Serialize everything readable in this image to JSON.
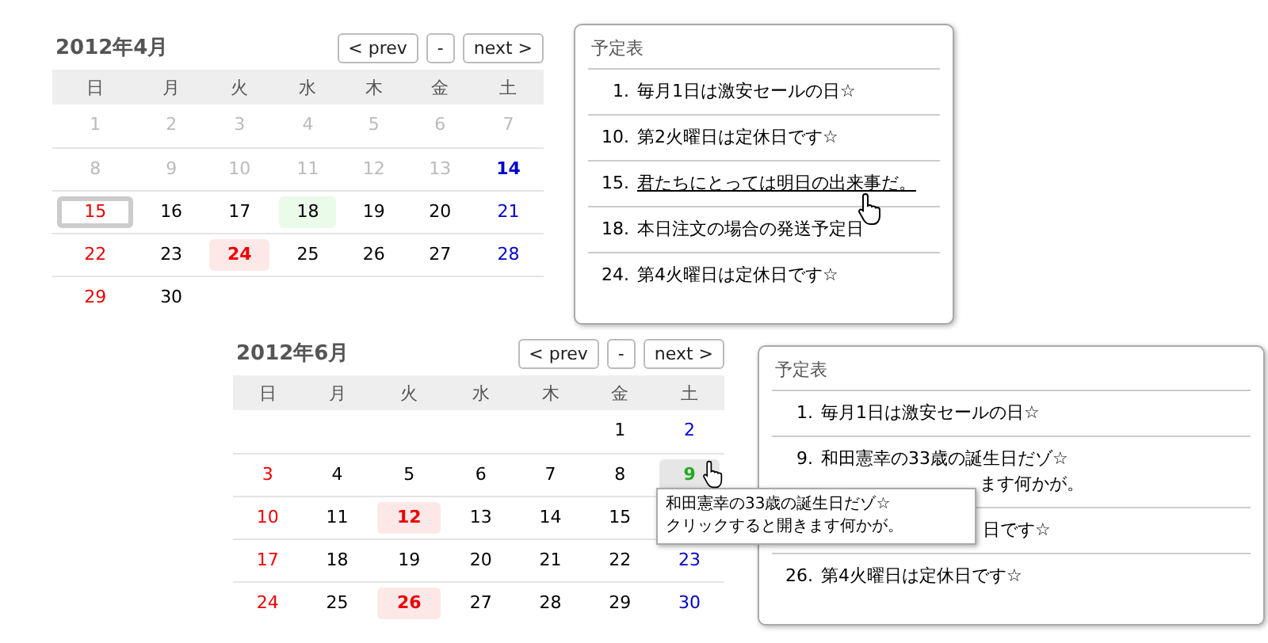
{
  "calendars": [
    {
      "title": "2012年4月",
      "buttons": [
        "< prev",
        "-",
        "next >"
      ],
      "weekdays": [
        "日",
        "月",
        "火",
        "水",
        "木",
        "金",
        "土"
      ],
      "weeks": [
        [
          {
            "day": "1",
            "kind": "past",
            "selected": false
          },
          {
            "day": "2",
            "kind": "past",
            "selected": false
          },
          {
            "day": "3",
            "kind": "past",
            "selected": false
          },
          {
            "day": "4",
            "kind": "past",
            "selected": false
          },
          {
            "day": "5",
            "kind": "past",
            "selected": false
          },
          {
            "day": "6",
            "kind": "past",
            "selected": false
          },
          {
            "day": "7",
            "kind": "past",
            "selected": false
          }
        ],
        [
          {
            "day": "8",
            "kind": "past",
            "selected": false
          },
          {
            "day": "9",
            "kind": "past",
            "selected": false
          },
          {
            "day": "10",
            "kind": "past",
            "selected": false
          },
          {
            "day": "11",
            "kind": "past",
            "selected": false
          },
          {
            "day": "12",
            "kind": "past",
            "selected": false
          },
          {
            "day": "13",
            "kind": "past",
            "selected": false
          },
          {
            "day": "14",
            "kind": "saturday",
            "bold": true,
            "selected": false
          }
        ],
        [
          {
            "day": "15",
            "kind": "sunday",
            "selected": true
          },
          {
            "day": "16",
            "kind": "weekday",
            "selected": false
          },
          {
            "day": "17",
            "kind": "weekday",
            "selected": false
          },
          {
            "day": "18",
            "kind": "weekday",
            "event": true,
            "selected": false
          },
          {
            "day": "19",
            "kind": "weekday",
            "selected": false
          },
          {
            "day": "20",
            "kind": "weekday",
            "selected": false
          },
          {
            "day": "21",
            "kind": "saturday",
            "selected": false
          }
        ],
        [
          {
            "day": "22",
            "kind": "sunday",
            "selected": false
          },
          {
            "day": "23",
            "kind": "weekday",
            "selected": false
          },
          {
            "day": "24",
            "kind": "weekday",
            "closed": true,
            "selected": false
          },
          {
            "day": "25",
            "kind": "weekday",
            "selected": false
          },
          {
            "day": "26",
            "kind": "weekday",
            "selected": false
          },
          {
            "day": "27",
            "kind": "weekday",
            "selected": false
          },
          {
            "day": "28",
            "kind": "saturday",
            "selected": false
          }
        ],
        [
          {
            "day": "29",
            "kind": "sunday",
            "selected": false
          },
          {
            "day": "30",
            "kind": "weekday",
            "selected": false
          },
          {
            "kind": "blank"
          },
          {
            "kind": "blank"
          },
          {
            "kind": "blank"
          },
          {
            "kind": "blank"
          },
          {
            "kind": "blank"
          }
        ]
      ]
    },
    {
      "title": "2012年6月",
      "buttons": [
        "< prev",
        "-",
        "next >"
      ],
      "weekdays": [
        "日",
        "月",
        "火",
        "水",
        "木",
        "金",
        "土"
      ],
      "weeks": [
        [
          {
            "kind": "blank"
          },
          {
            "kind": "blank"
          },
          {
            "kind": "blank"
          },
          {
            "kind": "blank"
          },
          {
            "kind": "blank"
          },
          {
            "day": "1",
            "kind": "weekday"
          },
          {
            "day": "2",
            "kind": "saturday"
          }
        ],
        [
          {
            "day": "3",
            "kind": "sunday"
          },
          {
            "day": "4",
            "kind": "weekday"
          },
          {
            "day": "5",
            "kind": "weekday"
          },
          {
            "day": "6",
            "kind": "weekday"
          },
          {
            "day": "7",
            "kind": "weekday"
          },
          {
            "day": "8",
            "kind": "weekday"
          },
          {
            "day": "9",
            "kind": "saturday",
            "hover": true
          }
        ],
        [
          {
            "day": "10",
            "kind": "sunday"
          },
          {
            "day": "11",
            "kind": "weekday"
          },
          {
            "day": "12",
            "kind": "weekday",
            "closed": true
          },
          {
            "day": "13",
            "kind": "weekday"
          },
          {
            "day": "14",
            "kind": "weekday"
          },
          {
            "day": "15",
            "kind": "weekday"
          },
          {
            "kind": "blank"
          }
        ],
        [
          {
            "day": "17",
            "kind": "sunday"
          },
          {
            "day": "18",
            "kind": "weekday"
          },
          {
            "day": "19",
            "kind": "weekday"
          },
          {
            "day": "20",
            "kind": "weekday"
          },
          {
            "day": "21",
            "kind": "weekday"
          },
          {
            "day": "22",
            "kind": "weekday"
          },
          {
            "day": "23",
            "kind": "saturday"
          }
        ],
        [
          {
            "day": "24",
            "kind": "sunday"
          },
          {
            "day": "25",
            "kind": "weekday"
          },
          {
            "day": "26",
            "kind": "weekday",
            "closed": true
          },
          {
            "day": "27",
            "kind": "weekday"
          },
          {
            "day": "28",
            "kind": "weekday"
          },
          {
            "day": "29",
            "kind": "weekday"
          },
          {
            "day": "30",
            "kind": "saturday"
          }
        ]
      ]
    }
  ],
  "schedules": [
    {
      "title": "予定表",
      "items": [
        {
          "number": "1.",
          "text": "毎月1日は激安セールの日☆",
          "kind": "plain"
        },
        {
          "number": "10.",
          "text": "第2火曜日は定休日です☆",
          "kind": "plain"
        },
        {
          "number": "15.",
          "text": "君たちにとっては明日の出来事だ。",
          "kind": "link"
        },
        {
          "number": "18.",
          "text": "本日注文の場合の発送予定日",
          "kind": "plain"
        },
        {
          "number": "24.",
          "text": "第4火曜日は定休日です☆",
          "kind": "plain"
        }
      ]
    },
    {
      "title": "予定表",
      "items": [
        {
          "number": "1.",
          "text": "毎月1日は激安セールの日☆",
          "kind": "plain"
        },
        {
          "number": "9.",
          "text": "和田憲幸の33歳の誕生日だゾ☆",
          "more": "ます何かが。",
          "kind": "plain"
        },
        {
          "text": "日です☆",
          "kind": "partial"
        },
        {
          "number": "26.",
          "text": "第4火曜日は定休日です☆",
          "kind": "plain"
        }
      ]
    }
  ],
  "tooltip": {
    "lines": [
      "和田憲幸の33歳の誕生日だゾ☆",
      "クリックすると開きます何かが。"
    ]
  }
}
